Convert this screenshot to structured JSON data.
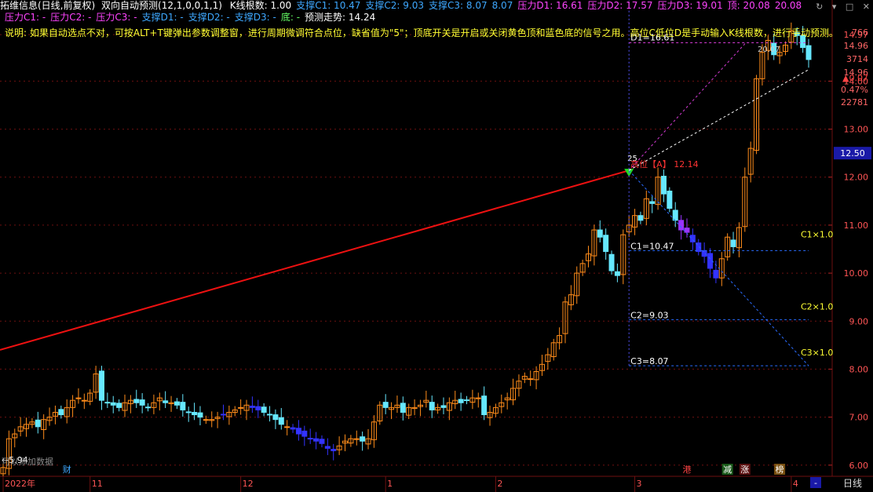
{
  "header": {
    "title": "拓维信息(日线,前复权)",
    "indicator_name": "双向自动预测(12,1,0,0,1,1)",
    "items_line1": [
      {
        "label": "K线根数",
        "value": "1.00",
        "color": "#ffffff"
      },
      {
        "label": "支撑C1",
        "value": "10.47",
        "color": "#3ea8ff"
      },
      {
        "label": "支撑C2",
        "value": "9.03",
        "color": "#3ea8ff"
      },
      {
        "label": "支撑C3",
        "value": "8.07",
        "color": "#3ea8ff"
      },
      {
        "label": "",
        "value": "8.07",
        "color": "#3ea8ff"
      },
      {
        "label": "压力D1",
        "value": "16.61",
        "color": "#ff44ff"
      },
      {
        "label": "压力D2",
        "value": "17.57",
        "color": "#ff44ff"
      },
      {
        "label": "压力D3",
        "value": "19.01",
        "color": "#ff44ff"
      },
      {
        "label": "顶",
        "value": "20.08",
        "color": "#ff44ff"
      },
      {
        "label": "",
        "value": "20.08",
        "color": "#ff44ff"
      }
    ],
    "items_line2": [
      {
        "label": "压力C1",
        "value": "-",
        "color": "#ff44ff"
      },
      {
        "label": "压力C2",
        "value": "-",
        "color": "#ff44ff"
      },
      {
        "label": "压力C3",
        "value": "-",
        "color": "#ff44ff"
      },
      {
        "label": "支撑D1",
        "value": "-",
        "color": "#3ea8ff"
      },
      {
        "label": "支撑D2",
        "value": "-",
        "color": "#3ea8ff"
      },
      {
        "label": "支撑D3",
        "value": "-",
        "color": "#3ea8ff"
      },
      {
        "label": "底",
        "value": "-",
        "color": "#66ff66"
      },
      {
        "label": "预测走势",
        "value": "14.24",
        "color": "#ffffff"
      }
    ],
    "note": "说明: 如果自动选点不对，可按ALT+T键弹出参数调整窗，进行周期微调符合点位，缺省值为\"5\"；顶底开关是开启或关闭黄色顶和蓝色底的信号之用。高位C低位D是手动输入K线根数，进行手动预测。"
  },
  "chart_data": {
    "type": "candlestick",
    "y_range": [
      5.8,
      15.2
    ],
    "y_ticks": [
      "14.97",
      "14.00",
      "13.00",
      "12.00",
      "11.00",
      "10.00",
      "9.00",
      "8.00",
      "7.00",
      "6.00"
    ],
    "current_price_label": "12.50",
    "right_info": [
      "766",
      "14.96",
      "3714",
      "14.96",
      "▲0.07",
      "0.47%",
      "22781"
    ],
    "x_labels": [
      {
        "text": "2022年",
        "i": 0
      },
      {
        "text": "11",
        "i": 15
      },
      {
        "text": "12",
        "i": 41
      },
      {
        "text": "1",
        "i": 66
      },
      {
        "text": "2",
        "i": 85
      },
      {
        "text": "3",
        "i": 109
      },
      {
        "text": "4",
        "i": 136
      }
    ],
    "period_label": "日线",
    "event_tags": [
      {
        "text": "财",
        "i": 11,
        "bg": "#000000",
        "fg": "#3ea8ff"
      },
      {
        "text": "港",
        "i": 118,
        "bg": "#000000",
        "fg": "#ff4444"
      },
      {
        "text": "减",
        "i": 125,
        "bg": "#1a5a1a",
        "fg": "#ffffff"
      },
      {
        "text": "涨",
        "i": 128,
        "bg": "#5a1010",
        "fg": "#ffffff"
      },
      {
        "text": "榜",
        "i": 134,
        "bg": "#7a5010",
        "fg": "#ffffff"
      }
    ],
    "closes": [
      5.95,
      6.55,
      6.65,
      6.8,
      6.85,
      6.9,
      6.8,
      6.95,
      7.0,
      7.1,
      7.05,
      7.2,
      7.35,
      7.4,
      7.35,
      7.5,
      7.9,
      7.35,
      7.3,
      7.25,
      7.2,
      7.3,
      7.35,
      7.3,
      7.25,
      7.2,
      7.3,
      7.4,
      7.3,
      7.3,
      7.25,
      7.15,
      7.1,
      7.05,
      7.0,
      6.95,
      6.95,
      7.0,
      7.05,
      7.1,
      7.15,
      7.2,
      7.25,
      7.2,
      7.15,
      7.1,
      7.05,
      6.95,
      6.85,
      6.8,
      6.75,
      6.65,
      6.6,
      6.55,
      6.5,
      6.45,
      6.35,
      6.3,
      6.4,
      6.5,
      6.55,
      6.55,
      6.5,
      6.55,
      6.9,
      7.25,
      7.2,
      7.2,
      7.25,
      7.1,
      7.2,
      7.2,
      7.25,
      7.35,
      7.15,
      7.2,
      7.2,
      7.3,
      7.35,
      7.3,
      7.35,
      7.4,
      7.4,
      7.05,
      7.1,
      7.2,
      7.3,
      7.4,
      7.6,
      7.75,
      7.85,
      7.8,
      7.95,
      8.1,
      8.3,
      8.55,
      8.7,
      9.4,
      9.55,
      10.0,
      10.2,
      10.4,
      10.9,
      10.75,
      10.45,
      10.05,
      9.95,
      10.8,
      11.0,
      11.2,
      11.1,
      11.55,
      11.45,
      12.0,
      11.65,
      11.35,
      11.1,
      10.9,
      10.85,
      10.65,
      10.45,
      10.35,
      10.1,
      9.9,
      10.3,
      10.75,
      10.55,
      10.95,
      12.0,
      12.6,
      14.05,
      14.6,
      14.85,
      14.55,
      14.6,
      14.75,
      15.05,
      14.95,
      14.7,
      14.45
    ],
    "support_C": [
      {
        "label": "C1=10.47",
        "value": 10.47,
        "tag": "C1×1.0"
      },
      {
        "label": "C2=9.03",
        "value": 9.03,
        "tag": "C2×1.0"
      },
      {
        "label": "C3=8.07",
        "value": 8.07,
        "tag": "C3×1.0"
      }
    ],
    "pressure_D": [
      {
        "label": "D1=16.61",
        "value": 16.61
      }
    ],
    "apex_label": "高位【A】 12.14",
    "apex_bar_count": "25",
    "apex_value": 12.14,
    "low_label": "5.94",
    "bottom_text": "可以添加数据",
    "top_marker_value": "20.07",
    "forecast_value": 14.24,
    "colors": {
      "up": "#ff8c1a",
      "down": "#66e8ff",
      "down_strong": "#3333ff",
      "violet": "#9a33ff",
      "trend": "#ee1111",
      "support": "#2a6cff",
      "pressure": "#d43bd4",
      "forecast": "#ffffff",
      "grid": "#6e1010"
    }
  },
  "toolbar": {
    "icons": [
      "refresh-icon",
      "menu-icon",
      "lock-icon",
      "close-icon"
    ]
  }
}
